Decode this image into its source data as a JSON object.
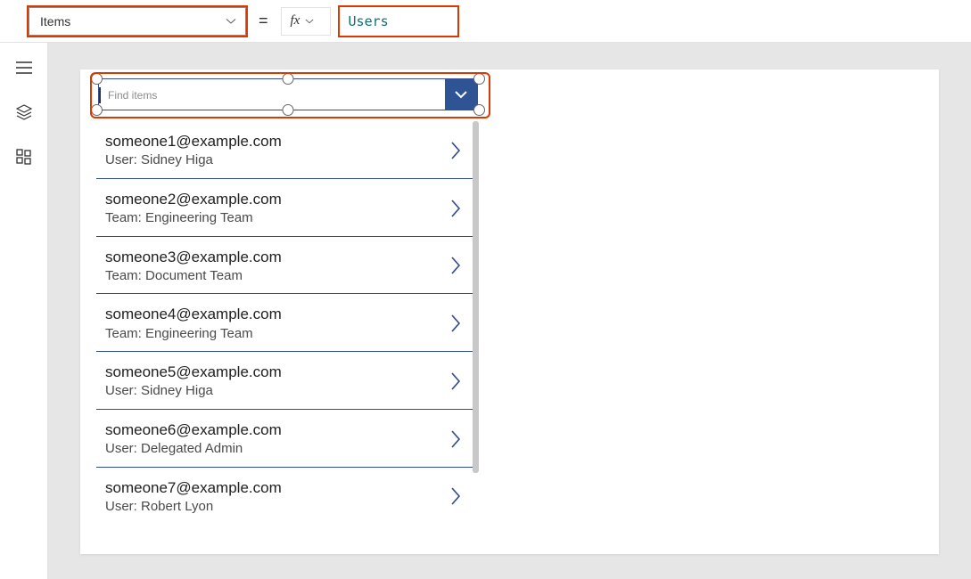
{
  "formula": {
    "property": "Items",
    "equals": "=",
    "fx_label": "fx",
    "expression": "Users"
  },
  "combobox": {
    "placeholder": "Find items"
  },
  "results": [
    {
      "email": "someone1@example.com",
      "sub": "User: Sidney Higa"
    },
    {
      "email": "someone2@example.com",
      "sub": "Team: Engineering Team"
    },
    {
      "email": "someone3@example.com",
      "sub": "Team: Document Team"
    },
    {
      "email": "someone4@example.com",
      "sub": "Team: Engineering Team"
    },
    {
      "email": "someone5@example.com",
      "sub": "User: Sidney Higa"
    },
    {
      "email": "someone6@example.com",
      "sub": "User: Delegated Admin"
    },
    {
      "email": "someone7@example.com",
      "sub": "User: Robert Lyon"
    }
  ]
}
